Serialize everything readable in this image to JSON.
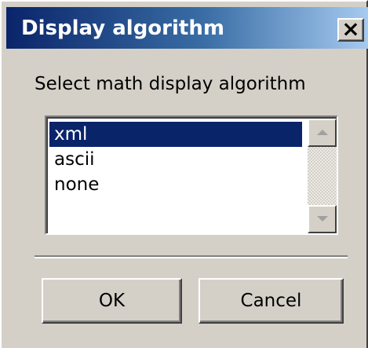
{
  "dialog": {
    "title": "Display algorithm",
    "close_label": "×",
    "prompt": "Select math display algorithm",
    "options": [
      {
        "label": "xml",
        "selected": true
      },
      {
        "label": "ascii",
        "selected": false
      },
      {
        "label": "none",
        "selected": false
      }
    ],
    "ok_label": "OK",
    "cancel_label": "Cancel"
  },
  "icons": {
    "close": "close-icon",
    "scroll_up": "arrow-up-icon",
    "scroll_down": "arrow-down-icon"
  },
  "colors": {
    "titlebar_start": "#0a246a",
    "titlebar_end": "#a6caf0",
    "selection": "#0a246a",
    "face": "#d4d0c8"
  }
}
